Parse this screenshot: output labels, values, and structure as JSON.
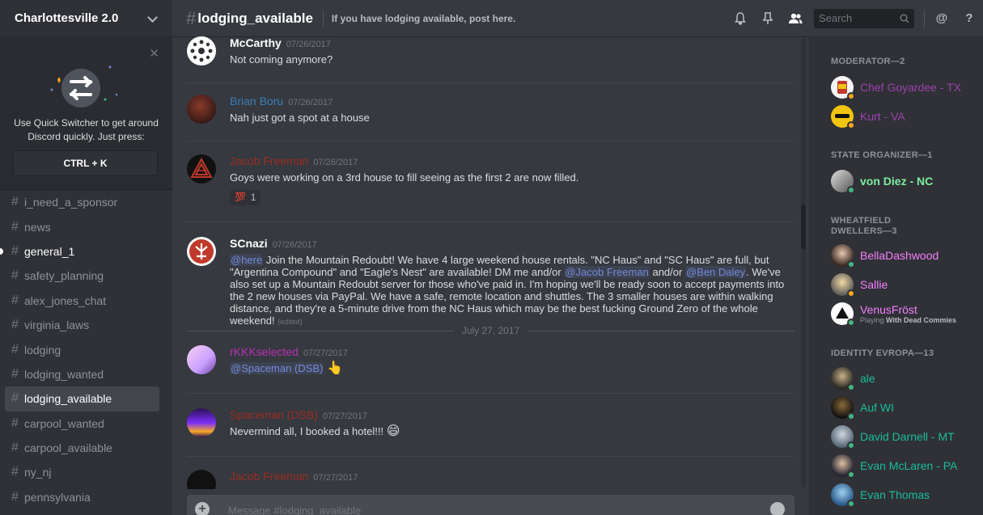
{
  "server": {
    "name": "Charlottesville 2.0"
  },
  "quick_switcher": {
    "text": "Use Quick Switcher to get around Discord quickly. Just press:",
    "shortcut": "CTRL + K"
  },
  "channels": [
    {
      "name": "i_need_a_sponsor",
      "state": "normal"
    },
    {
      "name": "news",
      "state": "normal"
    },
    {
      "name": "general_1",
      "state": "unread"
    },
    {
      "name": "safety_planning",
      "state": "normal"
    },
    {
      "name": "alex_jones_chat",
      "state": "normal"
    },
    {
      "name": "virginia_laws",
      "state": "normal"
    },
    {
      "name": "lodging",
      "state": "normal"
    },
    {
      "name": "lodging_wanted",
      "state": "normal"
    },
    {
      "name": "lodging_available",
      "state": "active"
    },
    {
      "name": "carpool_wanted",
      "state": "normal"
    },
    {
      "name": "carpool_available",
      "state": "normal"
    },
    {
      "name": "ny_nj",
      "state": "normal"
    },
    {
      "name": "pennsylvania",
      "state": "normal"
    }
  ],
  "header": {
    "channel": "lodging_available",
    "topic": "If you have lodging available, post here.",
    "search_placeholder": "Search"
  },
  "messages": [
    {
      "author": "McCarthy",
      "color": "#ffffff",
      "time": "07/26/2017",
      "text": "Not coming anymore?"
    },
    {
      "author": "Brian Boru",
      "color": "#3a7fb8",
      "time": "07/26/2017",
      "text": "Nah just got a spot at a house"
    },
    {
      "author": "Jacob Freeman",
      "color": "#992d22",
      "time": "07/26/2017",
      "text": "Goys were working on a 3rd house to fill seeing as the first 2 are now filled.",
      "reaction_count": "1"
    },
    {
      "author": "SCnazi",
      "color": "#ffffff",
      "time": "07/26/2017",
      "mention1": "@here",
      "text1": " Join the Mountain Redoubt! We have 4 large weekend house rentals. \"NC Haus\" and \"SC Haus\" are full, but \"Argentina Compound\" and \"Eagle's Nest\" are available! DM me and/or ",
      "mention2": "@Jacob Freeman",
      "text2": " and/or ",
      "mention3": "@Ben Daley",
      "text3": ". We've also set up a Mountain Redoubt server for those who've paid in. I'm hoping we'll be ready soon to accept payments into the 2 new houses via PayPal. We have a safe, remote location and shuttles. The 3 smaller houses are within walking distance, and they're a 5-minute drive from the NC Haus which may be the best fucking Ground Zero of the whole weekend!",
      "edited": "(edited)"
    },
    {
      "author": "rKKKselected",
      "color": "#b831b8",
      "time": "07/27/2017",
      "mention": "@Spaceman (DSB)"
    },
    {
      "author": "Spaceman (DSB)",
      "color": "#992d22",
      "time": "07/27/2017",
      "text": "Nevermind all, I booked a hotel!!!"
    },
    {
      "author": "Jacob Freeman",
      "color": "#992d22",
      "time": "07/27/2017"
    }
  ],
  "date_divider": "July 27, 2017",
  "composer": {
    "placeholder": "Message #lodging_available"
  },
  "member_groups": [
    {
      "title": "MODERATOR—2",
      "members": [
        {
          "name": "Chef Goyardee - TX",
          "color": "#9c40b0",
          "status": "idle"
        },
        {
          "name": "Kurt - VA",
          "color": "#9c40b0",
          "status": "idle"
        }
      ]
    },
    {
      "title": "STATE ORGANIZER—1",
      "members": [
        {
          "name": "von Diez - NC",
          "color": "#7bed9f",
          "status": "online"
        }
      ]
    },
    {
      "title": "WHEATFIELD DWELLERS—3",
      "members": [
        {
          "name": "BellaDashwood",
          "color": "#f47fff",
          "status": "online"
        },
        {
          "name": "Sallie",
          "color": "#f47fff",
          "status": "idle"
        },
        {
          "name": "VenusFröst",
          "color": "#f47fff",
          "status": "online",
          "activity_prefix": "Playing",
          "activity": "With Dead Commies"
        }
      ]
    },
    {
      "title": "IDENTITY EVROPA—13",
      "members": [
        {
          "name": "ale",
          "color": "#1abc9c",
          "status": "online"
        },
        {
          "name": "Auf WI",
          "color": "#1abc9c",
          "status": "online"
        },
        {
          "name": "David Darnell - MT",
          "color": "#1abc9c",
          "status": "online"
        },
        {
          "name": "Evan McLaren - PA",
          "color": "#1abc9c",
          "status": "online"
        },
        {
          "name": "Evan Thomas",
          "color": "#1abc9c",
          "status": "online"
        }
      ]
    }
  ],
  "status_colors": {
    "online": "#43b581",
    "idle": "#faa61a"
  }
}
